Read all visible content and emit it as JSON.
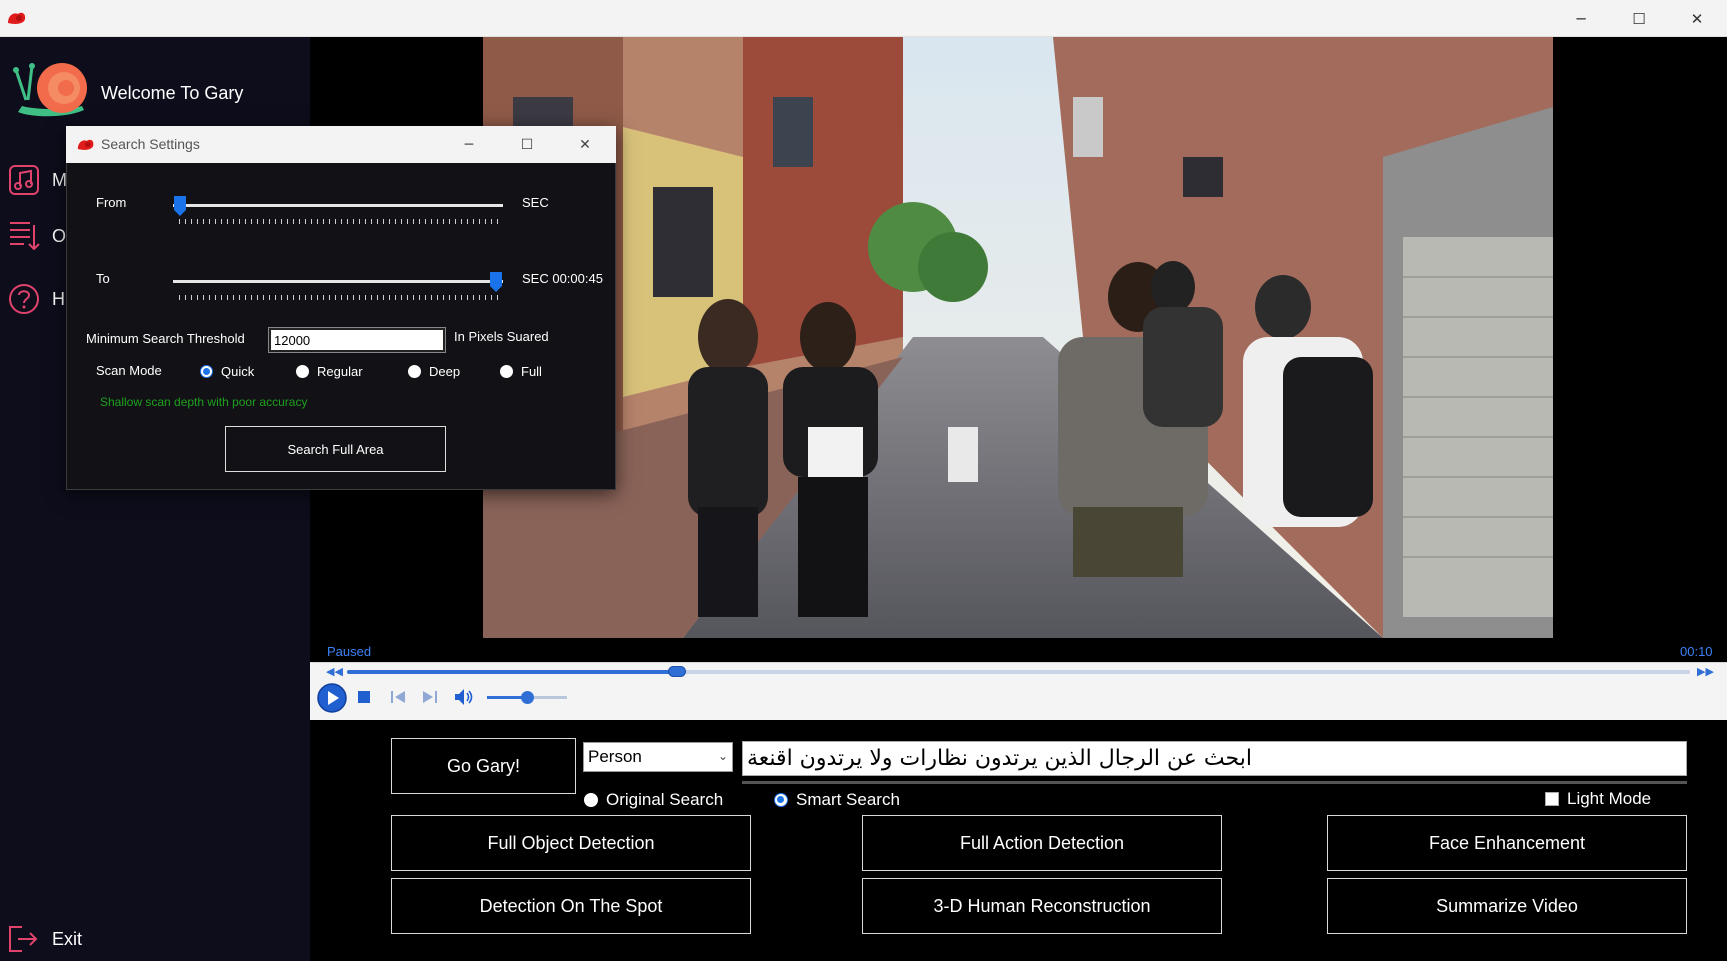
{
  "window": {
    "minimize": "─",
    "maximize": "☐",
    "close": "✕"
  },
  "sidebar": {
    "welcome": "Welcome To Gary",
    "items": [
      {
        "label": "M",
        "icon": "music-note-icon"
      },
      {
        "label": "Oc",
        "icon": "list-sort-icon"
      },
      {
        "label": "H",
        "icon": "help-circle-icon"
      }
    ],
    "exit_label": "Exit"
  },
  "player": {
    "status": "Paused",
    "time": "00:10",
    "seek_progress": 0.246,
    "volume_level": 0.5
  },
  "controls": {
    "go_label": "Go Gary!",
    "category_select": "Person",
    "query": "ابحث عن الرجال الذين يرتدون نظارات ولا يرتدون اقنعة",
    "search_modes": [
      {
        "label": "Original Search",
        "selected": false
      },
      {
        "label": "Smart Search",
        "selected": true
      }
    ],
    "light_mode_label": "Light Mode",
    "light_mode_checked": false,
    "buttons": [
      "Full Object Detection",
      "Full Action Detection",
      "Face Enhancement",
      "Detection On The Spot",
      "3-D Human Reconstruction",
      "Summarize Video"
    ]
  },
  "dialog": {
    "title": "Search Settings",
    "from_label": "From",
    "from_unit": "SEC",
    "to_label": "To",
    "to_unit": "SEC 00:00:45",
    "threshold_label": "Minimum Search Threshold",
    "threshold_value": "12000",
    "threshold_unit": "In Pixels Suared",
    "scan_mode_label": "Scan Mode",
    "scan_modes": [
      {
        "label": "Quick",
        "selected": true
      },
      {
        "label": "Regular",
        "selected": false
      },
      {
        "label": "Deep",
        "selected": false
      },
      {
        "label": "Full",
        "selected": false
      }
    ],
    "scan_hint": "Shallow scan depth with poor accuracy",
    "search_button": "Search Full Area",
    "from_value": 0.0,
    "to_value": 1.0
  },
  "colors": {
    "accent": "#1a73e8",
    "sidebar_bg": "#0d0d1c",
    "icon_pink": "#e0436c",
    "hint_green": "#1ea01e",
    "status_blue": "#3b82f6"
  }
}
